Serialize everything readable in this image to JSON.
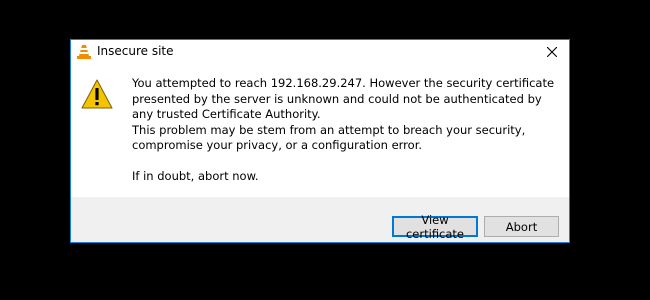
{
  "window": {
    "title": "Insecure site",
    "close_icon": "close-icon",
    "app_icon": "vlc-cone-icon"
  },
  "message": {
    "icon": "warning-icon",
    "paragraph1": "You attempted to reach 192.168.29.247. However the security certificate presented by the server is unknown and could not be authenticated by any trusted Certificate Authority.",
    "paragraph2": "This problem may be stem from an attempt to breach your security, compromise your privacy, or a configuration error.",
    "paragraph3": "If in doubt, abort now."
  },
  "buttons": {
    "view_certificate": "View certificate",
    "abort": "Abort"
  },
  "colors": {
    "accent": "#0078d7",
    "window_border": "#1883d7",
    "footer_bg": "#f0f0f0",
    "warning_yellow": "#f5c400"
  }
}
